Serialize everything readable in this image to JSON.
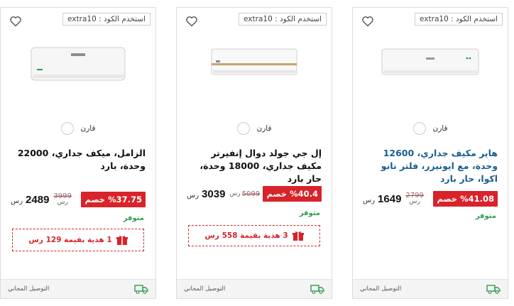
{
  "products": [
    {
      "coupon": "استخدم الكود : extra10",
      "compare_label": "قارن",
      "title": "هاير مكيف جداري، 12600 وحدة، مع ايونيزر، فلتر نانو اكوا، حار بارد",
      "discount": "%41.08 خصم",
      "old_price": "2799",
      "old_currency": "رس",
      "price": "1649",
      "currency": "رس",
      "stock": "متوفر",
      "gift": "",
      "delivery": "التوصيل المجاني"
    },
    {
      "coupon": "استخدم الكود : extra10",
      "compare_label": "قارن",
      "title": "إل جي جولد دوال إنفيرتر مكيف جداري، 18000 وحدة، حار بارد",
      "discount": "%40.4 خصم",
      "old_price": "5099",
      "old_currency": "رس",
      "price": "3039",
      "currency": "رس",
      "stock": "متوفر",
      "gift": "3 هدية بقيمة 558 رس",
      "delivery": "التوصيل المجاني"
    },
    {
      "coupon": "استخدم الكود : extra10",
      "compare_label": "قارن",
      "title": "الزامل، ميكف جداري، 22000 وحدة، بارد",
      "discount": "%37.75 خصم",
      "old_price": "3999",
      "old_currency": "رس",
      "price": "2489",
      "currency": "رس",
      "stock": "متوفر",
      "gift": "1 هدية بقيمة 129 رس",
      "delivery": "التوصيل المجاني"
    }
  ],
  "colors": {
    "discount": "#d8232a",
    "stock": "#2e9d4f",
    "title_link": "#1a5d8f"
  }
}
